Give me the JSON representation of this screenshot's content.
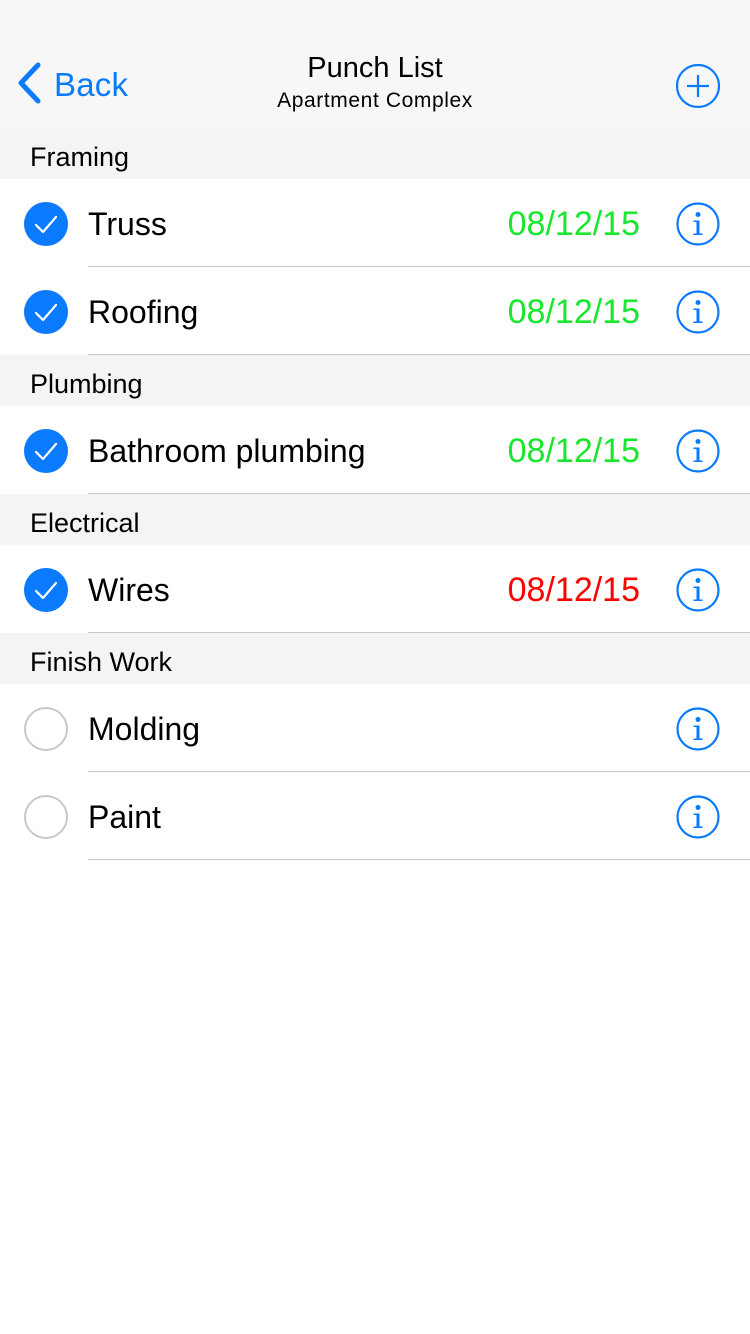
{
  "colors": {
    "accent": "#0a7aff",
    "date_ok": "#19e62e",
    "date_late": "#ff0000",
    "unchecked": "#c7c7cc"
  },
  "navbar": {
    "back_label": "Back",
    "back_icon": "chevron-left-icon",
    "title": "Punch List",
    "subtitle": "Apartment Complex",
    "add_icon": "plus-circle-icon"
  },
  "sections": [
    {
      "title": "Framing",
      "items": [
        {
          "label": "Truss",
          "date": "08/12/15",
          "checked": true,
          "status": "ok"
        },
        {
          "label": "Roofing",
          "date": "08/12/15",
          "checked": true,
          "status": "ok"
        }
      ]
    },
    {
      "title": "Plumbing",
      "items": [
        {
          "label": "Bathroom plumbing",
          "date": "08/12/15",
          "checked": true,
          "status": "ok"
        }
      ]
    },
    {
      "title": "Electrical",
      "items": [
        {
          "label": "Wires",
          "date": "08/12/15",
          "checked": true,
          "status": "late"
        }
      ]
    },
    {
      "title": "Finish Work",
      "items": [
        {
          "label": "Molding",
          "date": "",
          "checked": false,
          "status": "none"
        },
        {
          "label": "Paint",
          "date": "",
          "checked": false,
          "status": "none"
        }
      ]
    }
  ]
}
